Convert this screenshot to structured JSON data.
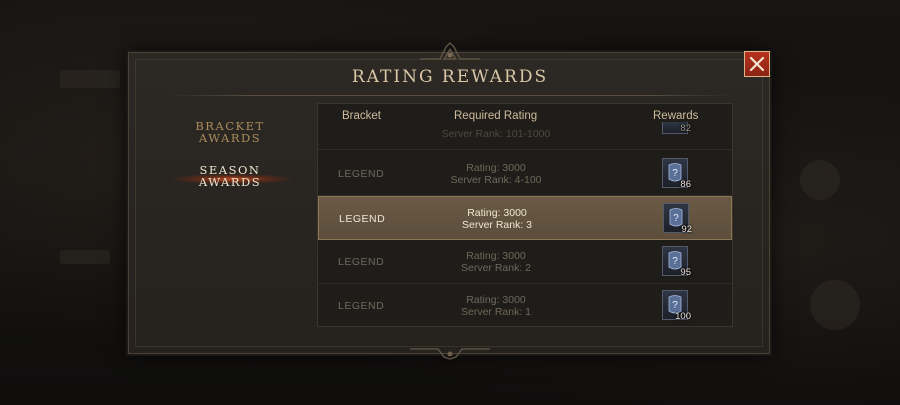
{
  "dialog": {
    "title": "RATING REWARDS",
    "close_label": "✕"
  },
  "sidebar": {
    "items": [
      {
        "line1": "BRACKET",
        "line2": "AWARDS",
        "active": false
      },
      {
        "line1": "SEASON",
        "line2": "AWARDS",
        "active": true
      }
    ]
  },
  "table": {
    "headers": {
      "bracket": "Bracket",
      "rating": "Required Rating",
      "rewards": "Rewards"
    },
    "partial_row": {
      "server_rank": "Server Rank: 101-1000",
      "reward_count": "82"
    },
    "rows": [
      {
        "bracket": "LEGEND",
        "rating": "Rating: 3000",
        "server_rank": "Server Rank: 4-100",
        "reward_count": "86",
        "selected": false
      },
      {
        "bracket": "LEGEND",
        "rating": "Rating: 3000",
        "server_rank": "Server Rank: 3",
        "reward_count": "92",
        "selected": true
      },
      {
        "bracket": "LEGEND",
        "rating": "Rating: 3000",
        "server_rank": "Server Rank: 2",
        "reward_count": "95",
        "selected": false
      },
      {
        "bracket": "LEGEND",
        "rating": "Rating: 3000",
        "server_rank": "Server Rank: 1",
        "reward_count": "100",
        "selected": false
      }
    ],
    "reward_icon": "question-rune-icon"
  },
  "colors": {
    "title": "#d9c7a6",
    "selected_row": "#6a5a45",
    "active_tab_glow": "#d7501e",
    "close_button": "#b6321f"
  }
}
